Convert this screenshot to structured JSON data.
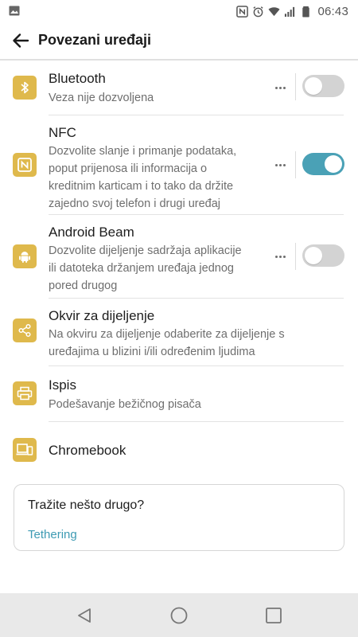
{
  "status_bar": {
    "time": "06:43",
    "icons": [
      "image-icon",
      "nfc-icon",
      "alarm-icon",
      "wifi-icon",
      "signal-icon",
      "battery-icon"
    ]
  },
  "app_bar": {
    "title": "Povezani uređaji",
    "back_icon": "arrow-left-icon"
  },
  "accent_colors": {
    "icon_bg": "#dfb94c",
    "toggle_on": "#4aa1b6",
    "link": "#3e9bb3"
  },
  "items": [
    {
      "title": "Bluetooth",
      "subtitle": "Veza nije dozvoljena",
      "icon": "bluetooth-icon",
      "has_toggle": true,
      "toggle_on": false
    },
    {
      "title": "NFC",
      "subtitle": "Dozvolite slanje i primanje podataka,\npoput prijenosa ili informacija o\nkreditnim karticam i to tako da držite\nzajedno svoj telefon i drugi uređaj",
      "icon": "nfc-icon",
      "has_toggle": true,
      "toggle_on": true
    },
    {
      "title": "Android Beam",
      "subtitle": "Dozvolite dijeljenje sadržaja aplikacije\nili datoteka držanjem uređaja jednog\npored drugog",
      "icon": "android-icon",
      "has_toggle": true,
      "toggle_on": false
    },
    {
      "title": "Okvir za dijeljenje",
      "subtitle": "Na okviru za dijeljenje odaberite za dijeljenje s\nuređajima u blizini i/ili određenim ljudima",
      "icon": "share-icon",
      "has_toggle": false
    },
    {
      "title": "Ispis",
      "subtitle": "Podešavanje bežičnog pisača",
      "icon": "printer-icon",
      "has_toggle": false
    },
    {
      "title": "Chromebook",
      "icon": "chromebook-icon",
      "has_toggle": false
    }
  ],
  "suggestion_card": {
    "title": "Tražite nešto drugo?",
    "link": "Tethering"
  },
  "nav_bar": {
    "icons": [
      "back-triangle-icon",
      "home-circle-icon",
      "recents-square-icon"
    ]
  }
}
